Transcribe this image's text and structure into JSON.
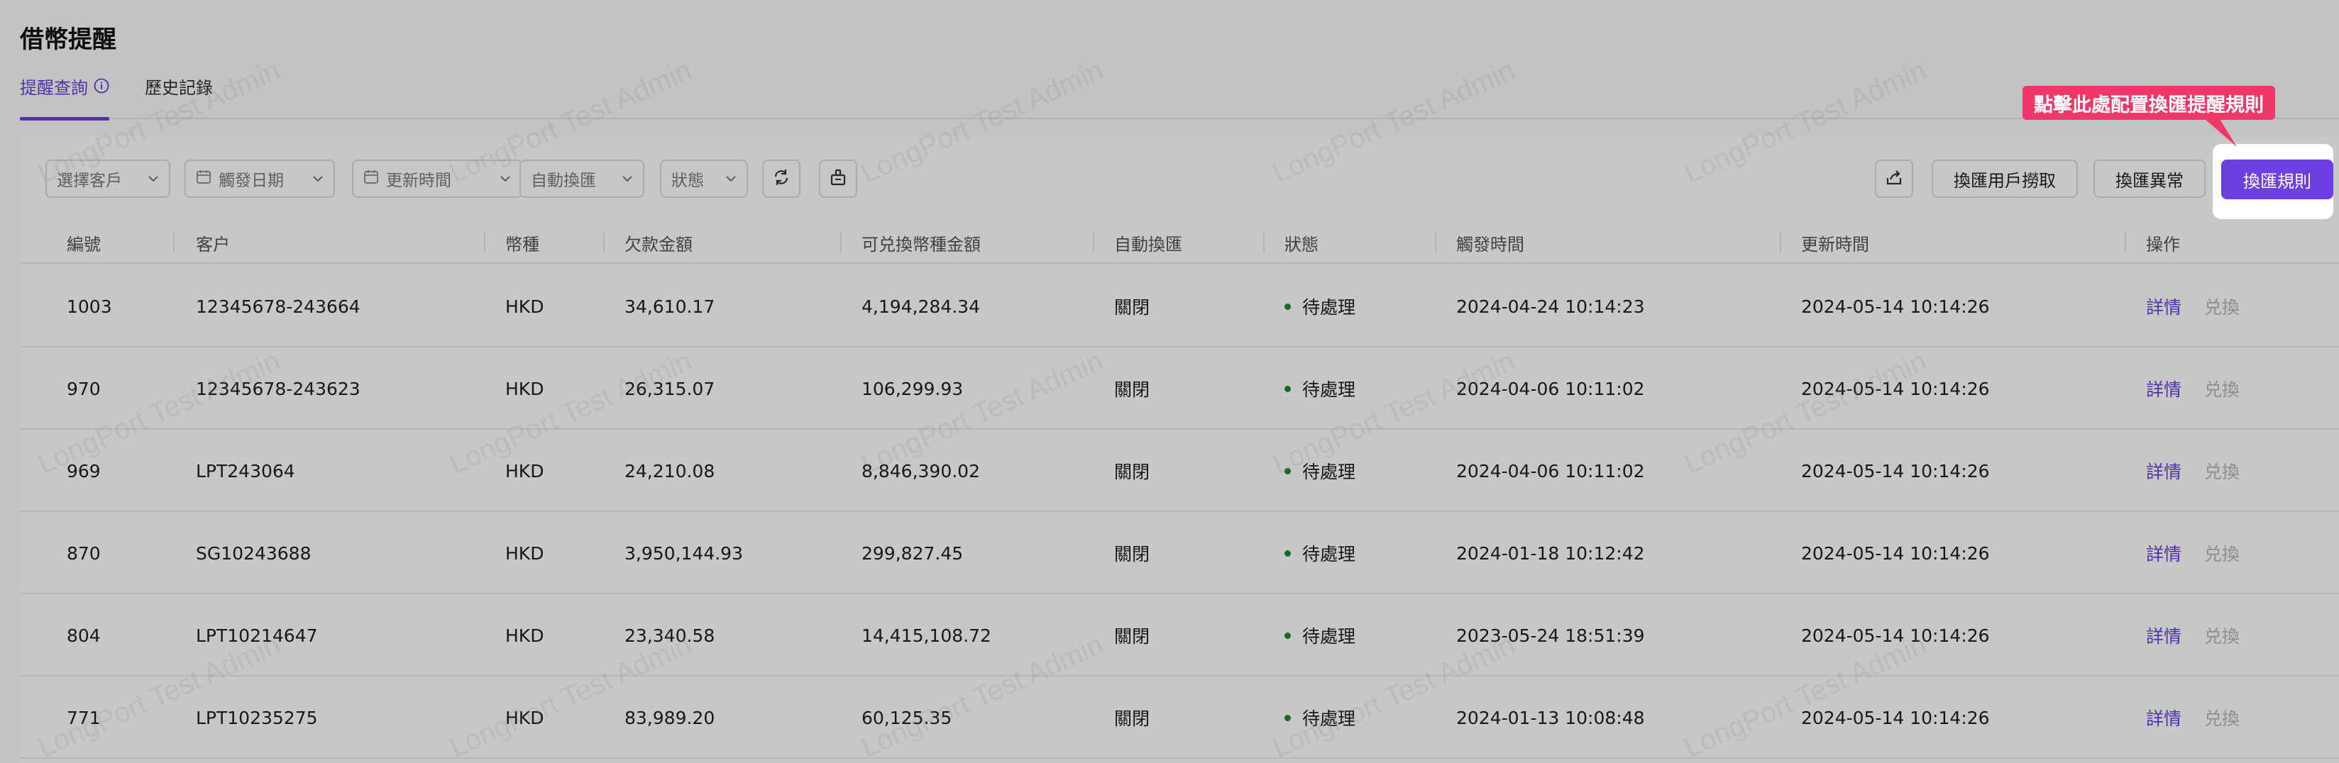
{
  "page": {
    "title": "借幣提醒"
  },
  "tabs": [
    {
      "label": "提醒查詢",
      "active": true
    },
    {
      "label": "歷史記錄",
      "active": false
    }
  ],
  "filters": {
    "customer_placeholder": "選擇客戶",
    "trigger_date_placeholder": "觸發日期",
    "update_time_placeholder": "更新時間",
    "auto_exchange_placeholder": "自動換匯",
    "status_placeholder": "狀態"
  },
  "actions": {
    "user_fetch_label": "換匯用戶撈取",
    "exception_label": "換匯異常",
    "rules_label": "換匯規則"
  },
  "callout": {
    "text": "點擊此處配置換匯提醒規則"
  },
  "watermark": "LongPort Test Admin",
  "table": {
    "columns": [
      "編號",
      "客户",
      "幣種",
      "欠款金額",
      "可兑換幣種金額",
      "自動換匯",
      "狀態",
      "觸發時間",
      "更新時間",
      "操作"
    ],
    "rows": [
      {
        "id": "1003",
        "customer": "12345678-243664",
        "currency": "HKD",
        "debt": "34,610.17",
        "exchangeable": "4,194,284.34",
        "auto": "關閉",
        "status": "待處理",
        "trigger": "2024-04-24 10:14:23",
        "updated": "2024-05-14 10:14:26",
        "detail": "詳情",
        "exchange": "兑換"
      },
      {
        "id": "970",
        "customer": "12345678-243623",
        "currency": "HKD",
        "debt": "26,315.07",
        "exchangeable": "106,299.93",
        "auto": "關閉",
        "status": "待處理",
        "trigger": "2024-04-06 10:11:02",
        "updated": "2024-05-14 10:14:26",
        "detail": "詳情",
        "exchange": "兑換"
      },
      {
        "id": "969",
        "customer": "LPT243064",
        "currency": "HKD",
        "debt": "24,210.08",
        "exchangeable": "8,846,390.02",
        "auto": "關閉",
        "status": "待處理",
        "trigger": "2024-04-06 10:11:02",
        "updated": "2024-05-14 10:14:26",
        "detail": "詳情",
        "exchange": "兑換"
      },
      {
        "id": "870",
        "customer": "SG10243688",
        "currency": "HKD",
        "debt": "3,950,144.93",
        "exchangeable": "299,827.45",
        "auto": "關閉",
        "status": "待處理",
        "trigger": "2024-01-18 10:12:42",
        "updated": "2024-05-14 10:14:26",
        "detail": "詳情",
        "exchange": "兑換"
      },
      {
        "id": "804",
        "customer": "LPT10214647",
        "currency": "HKD",
        "debt": "23,340.58",
        "exchangeable": "14,415,108.72",
        "auto": "關閉",
        "status": "待處理",
        "trigger": "2023-05-24 18:51:39",
        "updated": "2024-05-14 10:14:26",
        "detail": "詳情",
        "exchange": "兑換"
      },
      {
        "id": "771",
        "customer": "LPT10235275",
        "currency": "HKD",
        "debt": "83,989.20",
        "exchangeable": "60,125.35",
        "auto": "關閉",
        "status": "待處理",
        "trigger": "2024-01-13 10:08:48",
        "updated": "2024-05-14 10:14:26",
        "detail": "詳情",
        "exchange": "兑換"
      }
    ]
  },
  "colors": {
    "accent": "#6c3fe0",
    "callout": "#ef3868",
    "status_pending": "#1c8a3a"
  }
}
